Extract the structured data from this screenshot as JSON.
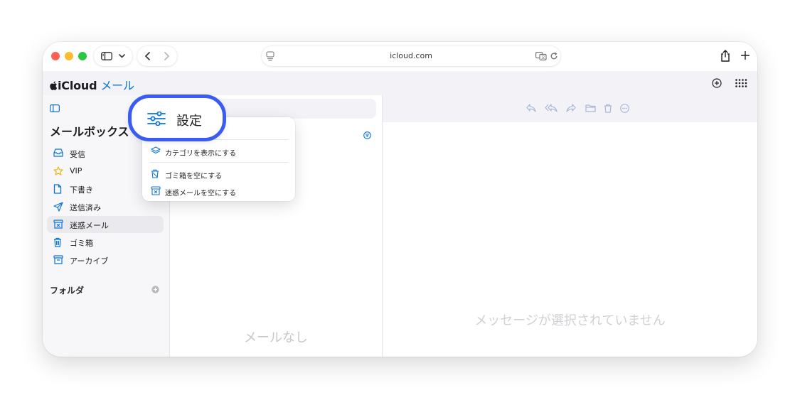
{
  "browser": {
    "url": "icloud.com",
    "icons": [
      "sidebar-icon",
      "chevron-down-icon",
      "back-icon",
      "forward-icon",
      "page-icon",
      "translate-icon",
      "reload-icon",
      "share-icon",
      "new-tab-icon"
    ]
  },
  "app": {
    "brand_prefix": "iCloud",
    "brand_app": "メール",
    "header_icons": [
      "add-icon",
      "apps-grid-icon"
    ]
  },
  "sidebar": {
    "title": "メールボックス",
    "items": [
      {
        "label": "受信",
        "icon": "inbox-icon"
      },
      {
        "label": "VIP",
        "icon": "star-icon"
      },
      {
        "label": "下書き",
        "icon": "draft-icon"
      },
      {
        "label": "送信済み",
        "icon": "sent-icon"
      },
      {
        "label": "迷惑メール",
        "icon": "junk-icon",
        "selected": true
      },
      {
        "label": "ゴミ箱",
        "icon": "trash-icon"
      },
      {
        "label": "アーカイブ",
        "icon": "archive-icon"
      }
    ],
    "folders_label": "フォルダ"
  },
  "message_list": {
    "empty_text": "メールなし"
  },
  "reader": {
    "toolbar_icons": [
      "reply-icon",
      "reply-all-icon",
      "forward-icon",
      "folder-icon",
      "trash-icon",
      "more-icon"
    ],
    "empty_text": "メッセージが選択されていません"
  },
  "settings_menu": {
    "callout_label": "設定",
    "items": [
      {
        "label": "カテゴリを表示にする",
        "icon": "layers-icon"
      },
      {
        "label": "ゴミ箱を空にする",
        "icon": "trash-icon"
      },
      {
        "label": "迷惑メールを空にする",
        "icon": "junk-icon"
      }
    ]
  },
  "colors": {
    "accent": "#0a74da",
    "callout_border": "#3b5bf5",
    "icon_blue": "#0a74da",
    "muted_text": "#c7c7cc"
  }
}
